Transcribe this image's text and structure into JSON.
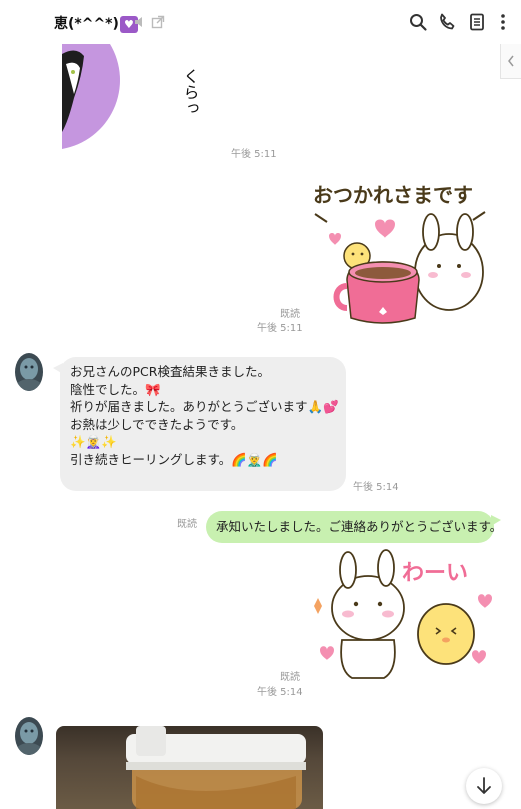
{
  "header": {
    "title": "恵(*^^*)",
    "title_badge_icon": "heart-icon",
    "icons": [
      "speaker-icon",
      "external-window-icon",
      "search-icon",
      "phone-icon",
      "notes-icon",
      "more-icon"
    ]
  },
  "messages": [
    {
      "type": "sticker",
      "side": "in",
      "time": "午後 5:11",
      "sticker_text": "くらっ",
      "sticker_desc": "cat"
    },
    {
      "type": "sticker",
      "side": "out",
      "read": "既読",
      "time": "午後 5:11",
      "sticker_text": "おつかれさまです"
    },
    {
      "type": "text",
      "side": "in",
      "time": "午後 5:14",
      "lines": [
        "お兄さんのPCR検査結果きました。",
        "陰性でした。🎀",
        "祈りが届きました。ありがとうございます🙏💕",
        "お熱は少しでできたようです。",
        "✨🧝‍♀️✨",
        "引き続きヒーリングします。🌈🧝‍♂️🌈"
      ]
    },
    {
      "type": "text",
      "side": "out",
      "read": "既読",
      "text": "承知いたしました。ご連絡ありがとうございます。"
    },
    {
      "type": "sticker",
      "side": "out",
      "read": "既読",
      "time": "午後 5:14",
      "sticker_text": "わーい"
    },
    {
      "type": "image",
      "side": "in"
    }
  ],
  "scroll_button_icon": "arrow-down-icon",
  "colors": {
    "incoming_bubble": "#eeeeee",
    "outgoing_bubble": "#c8f0b0",
    "badge": "#9b59c7"
  }
}
